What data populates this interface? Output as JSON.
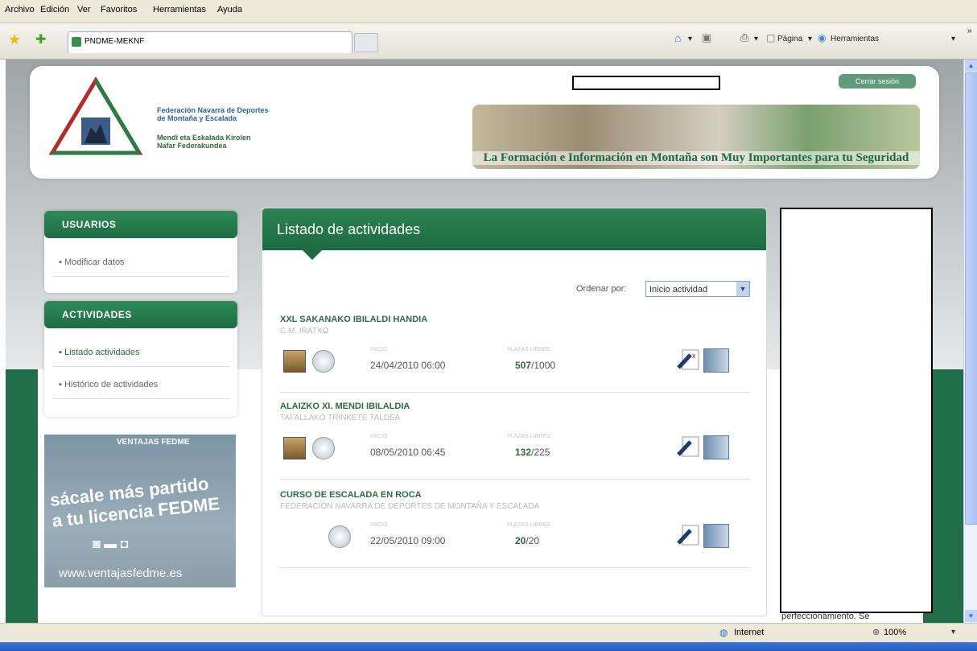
{
  "browser": {
    "menu": [
      "Archivo",
      "Edición",
      "Ver",
      "Favoritos",
      "Herramientas",
      "Ayuda"
    ],
    "tab_title": "PNDME-MEKNF",
    "toolbar": {
      "page_label": "Página",
      "tools_label": "Herramientas"
    },
    "status": {
      "zone": "Internet",
      "zoom": "100%"
    }
  },
  "header": {
    "federation_es_1": "Federación Navarra de Deportes",
    "federation_es_2": "de Montaña y Escalada",
    "federation_eu_1": "Mendi eta Eskalada Kirolen",
    "federation_eu_2": "Nafar Federakundea",
    "logout": "Cerrar sesión",
    "slogan": "La Formación e Información en Montaña son Muy Importantes para tu Seguridad"
  },
  "sidebar": {
    "users_title": "USUARIOS",
    "users_items": [
      "Modificar datos"
    ],
    "activities_title": "ACTIVIDADES",
    "activities_items": [
      "Listado actividades",
      "Histórico de actividades"
    ],
    "ad": {
      "top": "VENTAJAS FEDME",
      "slogan_1": "sácale más partido",
      "slogan_2": "a tu licencia FEDME",
      "url": "www.ventajasfedme.es"
    }
  },
  "main": {
    "title": "Listado de actividades",
    "sort_label": "Ordenar por:",
    "sort_value": "Inicio actividad",
    "label_start": "INICIO",
    "label_free": "PLAZAS LIBRES",
    "activities": [
      {
        "title": "XXL SAKANAKO IBILALDI HANDIA",
        "org": "C.M. IRATXO",
        "start": "24/04/2010 06:00",
        "free": "507",
        "total": "/1000"
      },
      {
        "title": "ALAIZKO XI. MENDI IBILALDIA",
        "org": "TAFALLAKO TRINKETE TALDEA",
        "start": "08/05/2010 06:45",
        "free": "132",
        "total": "/225"
      },
      {
        "title": "CURSO DE ESCALADA EN ROCA",
        "org": "FEDERACIÓN NAVARRA DE DEPORTES DE MONTAÑA Y ESCALADA",
        "start": "22/05/2010 09:00",
        "free": "20",
        "total": "/20"
      }
    ]
  },
  "right_column_text": "perfeccionamiento. Se"
}
